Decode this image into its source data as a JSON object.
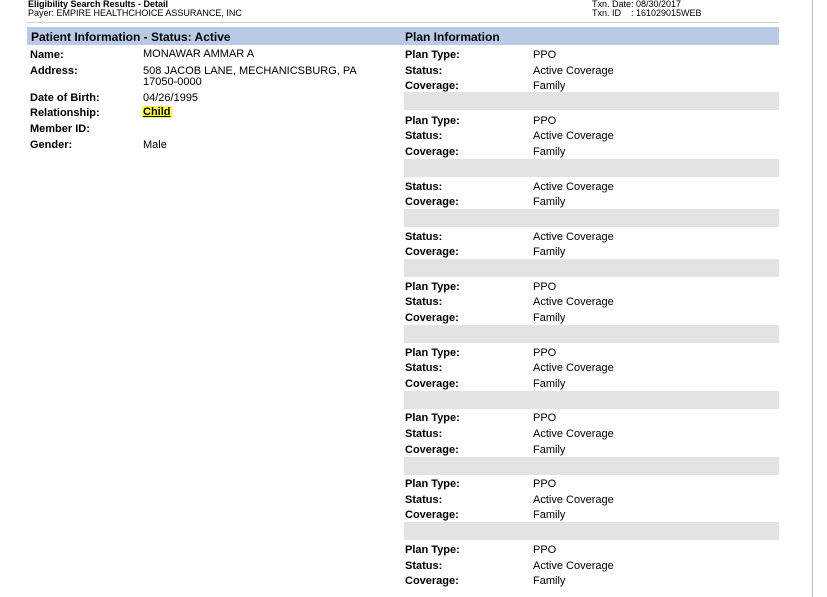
{
  "header": {
    "report_title": "Eligibility Search Results - Detail",
    "payer_line": "Payer: EMPIRE HEALTHCHOICE ASSURANCE, INC",
    "txn_date_line": "Txn. Date: 08/30/2017",
    "txn_id_line": "Txn. ID    : 161029015WEB"
  },
  "patient": {
    "section_title": "Patient Information - Status: Active",
    "name_label": "Name:",
    "name": "MONAWAR AMMAR A",
    "address_label": "Address:",
    "address_line1": "508 JACOB LANE, MECHANICSBURG, PA",
    "address_line2": "17050-0000",
    "dob_label": "Date of Birth:",
    "dob": "04/26/1995",
    "relationship_label": "Relationship:",
    "relationship": "Child",
    "member_id_label": "Member ID:",
    "member_id": "",
    "gender_label": "Gender:",
    "gender": "Male"
  },
  "plan": {
    "section_title": "Plan Information",
    "labels": {
      "plan_type": "Plan Type:",
      "status": "Status:",
      "coverage": "Coverage:"
    },
    "entries": [
      {
        "plan_type": "PPO",
        "status": "Active Coverage",
        "coverage": "Family"
      },
      {
        "plan_type": "PPO",
        "status": "Active Coverage",
        "coverage": "Family"
      },
      {
        "plan_type": "",
        "status": "Active Coverage",
        "coverage": "Family"
      },
      {
        "plan_type": "",
        "status": "Active Coverage",
        "coverage": "Family"
      },
      {
        "plan_type": "PPO",
        "status": "Active Coverage",
        "coverage": "Family"
      },
      {
        "plan_type": "PPO",
        "status": "Active Coverage",
        "coverage": "Family"
      },
      {
        "plan_type": "PPO",
        "status": "Active Coverage",
        "coverage": "Family"
      },
      {
        "plan_type": "PPO",
        "status": "Active Coverage",
        "coverage": "Family"
      },
      {
        "plan_type": "PPO",
        "status": "Active Coverage",
        "coverage": "Family"
      }
    ]
  },
  "colors": {
    "section_bar": "#b8cae6",
    "row_shade": "#e3e3e3",
    "highlight": "#ffff3a"
  }
}
